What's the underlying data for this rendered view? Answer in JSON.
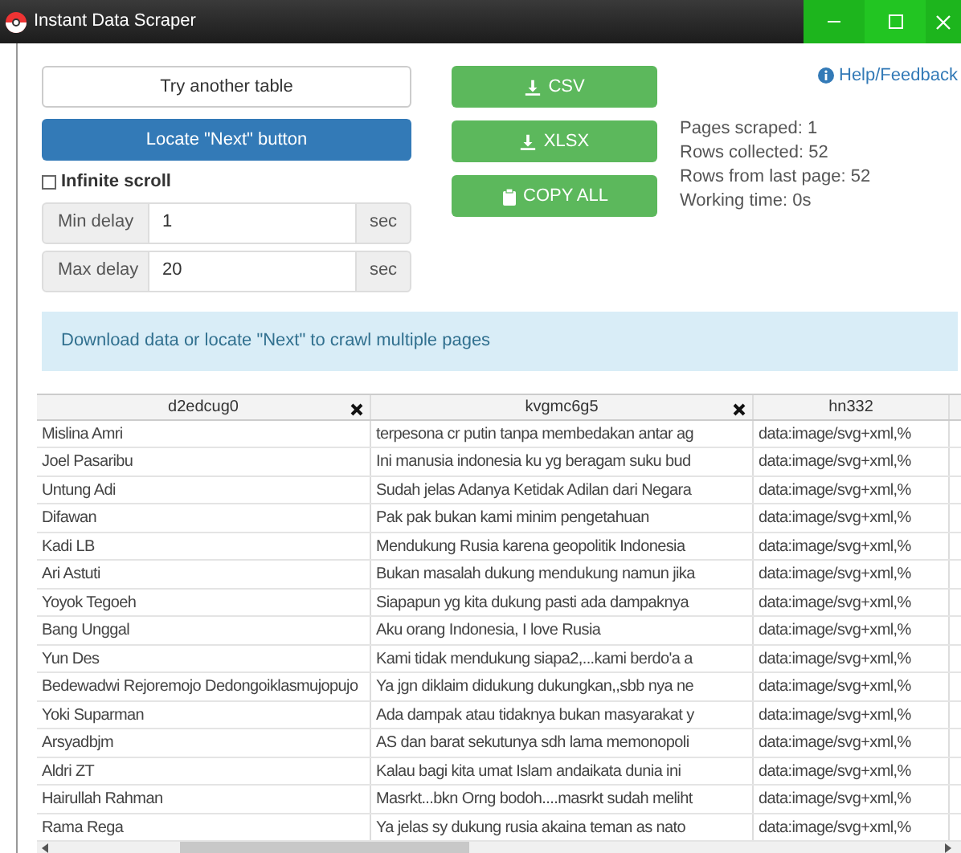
{
  "window": {
    "title": "Instant Data Scraper"
  },
  "buttons": {
    "try_another": "Try another table",
    "locate_next": "Locate \"Next\" button",
    "csv": "CSV",
    "xlsx": "XLSX",
    "copy_all": "COPY ALL"
  },
  "help_link": "Help/Feedback",
  "infinite_scroll": {
    "label": "Infinite scroll",
    "checked": false
  },
  "delays": [
    {
      "label": "Min delay",
      "value": "1",
      "unit": "sec"
    },
    {
      "label": "Max delay",
      "value": "20",
      "unit": "sec"
    }
  ],
  "stats": [
    "Pages scraped: 1",
    "Rows collected: 52",
    "Rows from last page: 52",
    "Working time: 0s"
  ],
  "info_message": "Download data or locate \"Next\" to crawl multiple pages",
  "table": {
    "columns": [
      {
        "label": "d2edcug0",
        "closable": true
      },
      {
        "label": "kvgmc6g5",
        "closable": true
      },
      {
        "label": "hn332",
        "closable": false
      }
    ],
    "rows": [
      [
        "Mislina Amri",
        "terpesona cr putin tanpa membedakan antar ag",
        "data:image/svg+xml,%"
      ],
      [
        "Joel Pasaribu",
        "Ini manusia indonesia ku yg beragam suku bud",
        "data:image/svg+xml,%"
      ],
      [
        "Untung Adi",
        "Sudah jelas Adanya Ketidak Adilan dari Negara",
        "data:image/svg+xml,%"
      ],
      [
        "Difawan",
        "Pak pak bukan kami minim pengetahuan",
        "data:image/svg+xml,%"
      ],
      [
        "Kadi LB",
        "Mendukung Rusia karena geopolitik Indonesia",
        "data:image/svg+xml,%"
      ],
      [
        "Ari Astuti",
        "Bukan masalah dukung mendukung namun jika",
        "data:image/svg+xml,%"
      ],
      [
        "Yoyok Tegoeh",
        "Siapapun yg kita dukung pasti ada dampaknya",
        "data:image/svg+xml,%"
      ],
      [
        "Bang Unggal",
        "Aku orang Indonesia, I love Rusia",
        "data:image/svg+xml,%"
      ],
      [
        "Yun Des",
        "Kami tidak mendukung siapa2,...kami berdo'a a",
        "data:image/svg+xml,%"
      ],
      [
        "Bedewadwi Rejoremojo Dedongoiklasmujopujo",
        "Ya jgn diklaim didukung dukungkan,,sbb nya ne",
        "data:image/svg+xml,%"
      ],
      [
        "Yoki Suparman",
        "Ada dampak atau tidaknya bukan masyarakat y",
        "data:image/svg+xml,%"
      ],
      [
        "Arsyadbjm",
        "AS dan barat sekutunya sdh lama memonopoli",
        "data:image/svg+xml,%"
      ],
      [
        "Aldri ZT",
        "Kalau bagi kita umat Islam andaikata dunia ini",
        "data:image/svg+xml,%"
      ],
      [
        "Hairullah Rahman",
        "Masrkt...bkn Orng bodoh....masrkt sudah meliht",
        "data:image/svg+xml,%"
      ],
      [
        "Rama Rega",
        "Ya jelas sy dukung rusia akaina teman as nato",
        "data:image/svg+xml,%"
      ]
    ]
  }
}
